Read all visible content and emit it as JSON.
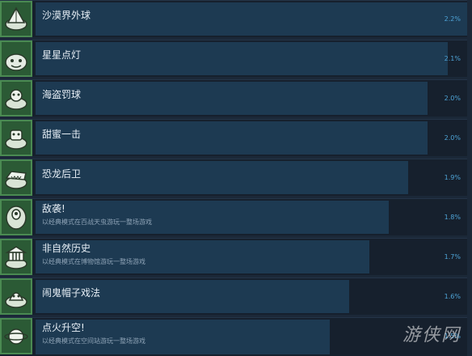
{
  "colors": {
    "background": "#1b2838",
    "row_bg": "#16202d",
    "progress_fill": "#1d3a52",
    "badge_bg": "#2b5a35",
    "percent_text": "#4ea3d6"
  },
  "achievements": [
    {
      "icon": "desert-ball-icon",
      "title": "沙漠界外球",
      "desc": "",
      "percent": "2.2%",
      "rate": 0.022
    },
    {
      "icon": "star-light-icon",
      "title": "星星点灯",
      "desc": "",
      "percent": "2.1%",
      "rate": 0.021
    },
    {
      "icon": "pirate-penalty-icon",
      "title": "海盗罚球",
      "desc": "",
      "percent": "2.0%",
      "rate": 0.02
    },
    {
      "icon": "sweet-hit-icon",
      "title": "甜蜜一击",
      "desc": "",
      "percent": "2.0%",
      "rate": 0.02
    },
    {
      "icon": "dinosaur-fullback-icon",
      "title": "恐龙后卫",
      "desc": "",
      "percent": "1.9%",
      "rate": 0.019
    },
    {
      "icon": "alien-attack-icon",
      "title": "敌袭!",
      "desc": "以经典模式在百战天虫游玩一整场游戏",
      "percent": "1.8%",
      "rate": 0.018
    },
    {
      "icon": "museum-history-icon",
      "title": "非自然历史",
      "desc": "以经典模式在博物馆游玩一整场游戏",
      "percent": "1.7%",
      "rate": 0.017
    },
    {
      "icon": "haunted-hat-icon",
      "title": "闹鬼帽子戏法",
      "desc": "",
      "percent": "1.6%",
      "rate": 0.016
    },
    {
      "icon": "planet-liftoff-icon",
      "title": "点火升空!",
      "desc": "以经典模式在空间站游玩一整场游戏",
      "percent": "1.5%",
      "rate": 0.015
    }
  ],
  "watermark": "游侠网"
}
